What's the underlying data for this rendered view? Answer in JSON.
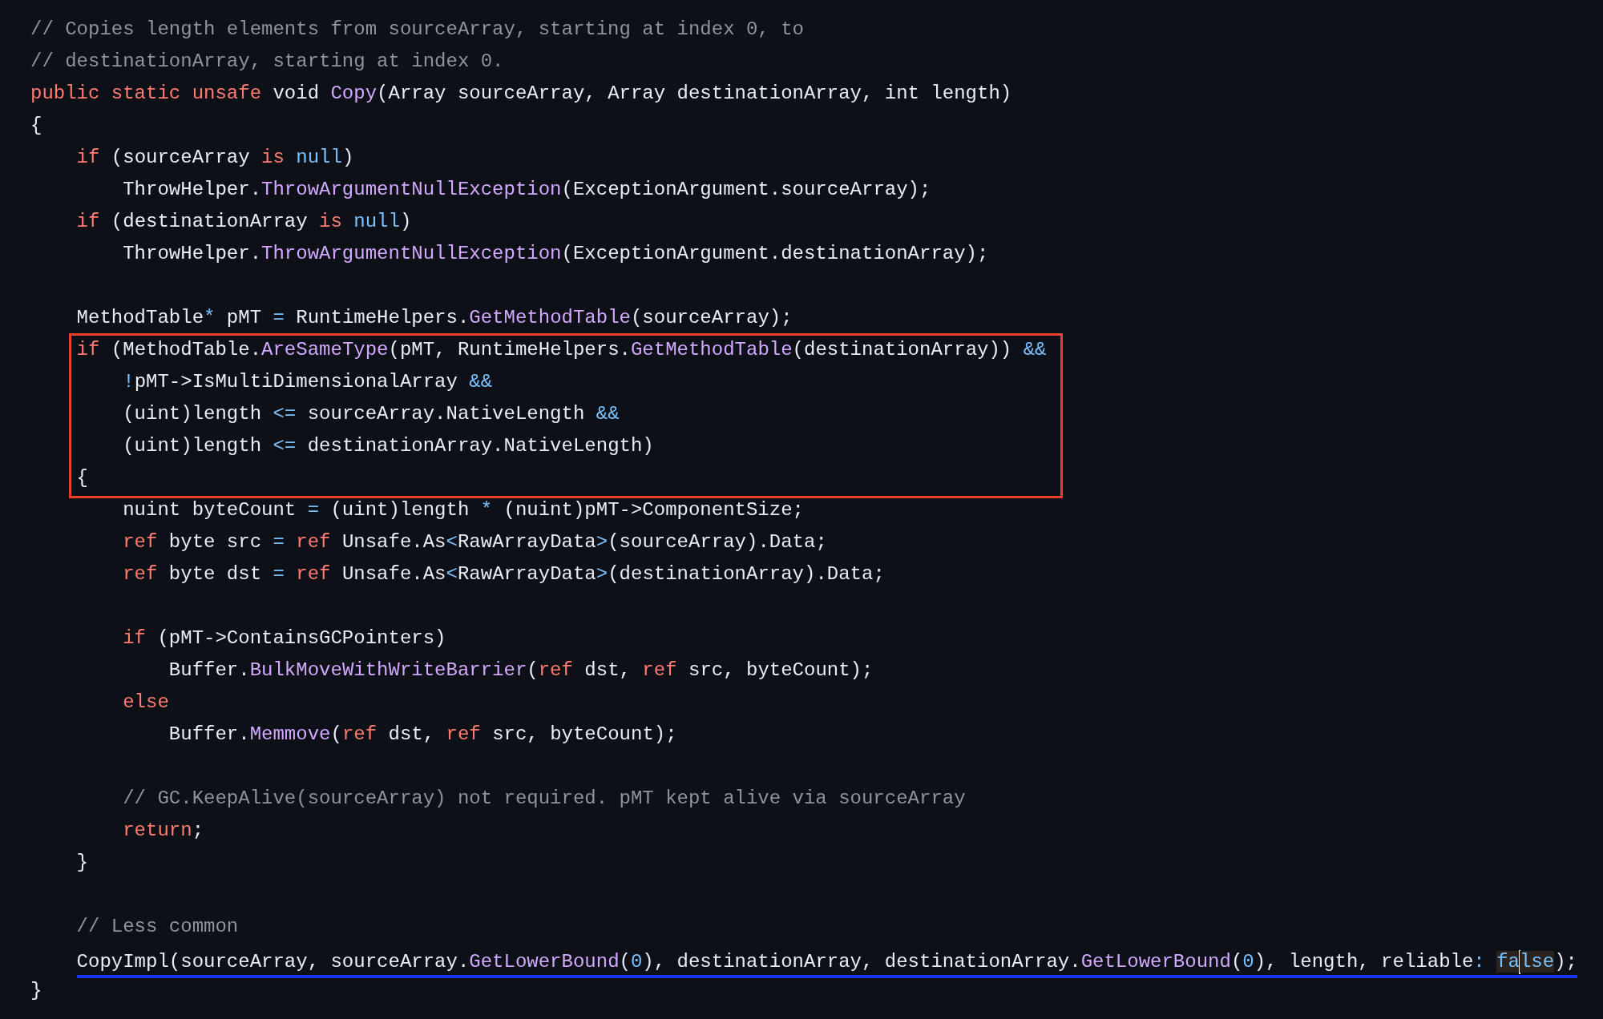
{
  "editor": {
    "lines": [
      {
        "kind": "code",
        "tokens": [
          {
            "kind": "comment",
            "text": "// Copies length elements from sourceArray, starting at index 0, to"
          }
        ]
      },
      {
        "kind": "code",
        "tokens": [
          {
            "kind": "comment",
            "text": "// destinationArray, starting at index 0."
          }
        ]
      },
      {
        "kind": "code",
        "tokens": [
          {
            "kind": "keyword",
            "text": "public static unsafe"
          },
          {
            "kind": "plain",
            "text": " void "
          },
          {
            "kind": "function",
            "text": "Copy"
          },
          {
            "kind": "plain",
            "text": "(Array sourceArray, Array destinationArray, int length)"
          }
        ]
      },
      {
        "kind": "code",
        "tokens": [
          {
            "kind": "plain",
            "text": "{"
          }
        ]
      },
      {
        "kind": "block",
        "children": [
          {
            "kind": "code",
            "tokens": [
              {
                "kind": "keyword",
                "text": "if"
              },
              {
                "kind": "plain",
                "text": " (sourceArray "
              },
              {
                "kind": "keyword",
                "text": "is "
              },
              {
                "kind": "constant",
                "text": "null"
              },
              {
                "kind": "plain",
                "text": ")"
              }
            ]
          },
          {
            "kind": "block",
            "children": [
              {
                "kind": "code",
                "tokens": [
                  {
                    "kind": "plain",
                    "text": "ThrowHelper."
                  },
                  {
                    "kind": "function",
                    "text": "ThrowArgumentNullException"
                  },
                  {
                    "kind": "plain",
                    "text": "(ExceptionArgument.sourceArray);"
                  }
                ]
              }
            ]
          },
          {
            "kind": "code",
            "tokens": [
              {
                "kind": "keyword",
                "text": "if"
              },
              {
                "kind": "plain",
                "text": " (destinationArray "
              },
              {
                "kind": "keyword",
                "text": "is "
              },
              {
                "kind": "constant",
                "text": "null"
              },
              {
                "kind": "plain",
                "text": ")"
              }
            ]
          },
          {
            "kind": "block",
            "children": [
              {
                "kind": "code",
                "tokens": [
                  {
                    "kind": "plain",
                    "text": "ThrowHelper."
                  },
                  {
                    "kind": "function",
                    "text": "ThrowArgumentNullException"
                  },
                  {
                    "kind": "plain",
                    "text": "(ExceptionArgument.destinationArray);"
                  }
                ]
              }
            ]
          },
          {
            "kind": "blank"
          },
          {
            "kind": "code",
            "tokens": [
              {
                "kind": "plain",
                "text": "MethodTable"
              },
              {
                "kind": "constant",
                "text": "*"
              },
              {
                "kind": "plain",
                "text": " pMT "
              },
              {
                "kind": "constant",
                "text": "="
              },
              {
                "kind": "plain",
                "text": " RuntimeHelpers."
              },
              {
                "kind": "function",
                "text": "GetMethodTable"
              },
              {
                "kind": "plain",
                "text": "(sourceArray);"
              }
            ]
          },
          {
            "kind": "frame",
            "children": [
              {
                "kind": "code",
                "tokens": [
                  {
                    "kind": "keyword",
                    "text": "if"
                  },
                  {
                    "kind": "plain",
                    "text": " (MethodTable."
                  },
                  {
                    "kind": "function",
                    "text": "AreSameType"
                  },
                  {
                    "kind": "plain",
                    "text": "(pMT, RuntimeHelpers."
                  },
                  {
                    "kind": "function",
                    "text": "GetMethodTable"
                  },
                  {
                    "kind": "plain",
                    "text": "(destinationArray)) "
                  },
                  {
                    "kind": "constant",
                    "text": "&&"
                  }
                ]
              },
              {
                "kind": "block",
                "children": [
                  {
                    "kind": "code",
                    "tokens": [
                      {
                        "kind": "constant",
                        "text": "!"
                      },
                      {
                        "kind": "plain",
                        "text": "pMT->IsMultiDimensionalArray "
                      },
                      {
                        "kind": "constant",
                        "text": "&&"
                      }
                    ]
                  },
                  {
                    "kind": "code",
                    "tokens": [
                      {
                        "kind": "plain",
                        "text": "(uint)length "
                      },
                      {
                        "kind": "constant",
                        "text": "<="
                      },
                      {
                        "kind": "plain",
                        "text": " sourceArray.NativeLength "
                      },
                      {
                        "kind": "constant",
                        "text": "&&"
                      }
                    ]
                  },
                  {
                    "kind": "code",
                    "tokens": [
                      {
                        "kind": "plain",
                        "text": "(uint)length "
                      },
                      {
                        "kind": "constant",
                        "text": "<="
                      },
                      {
                        "kind": "plain",
                        "text": " destinationArray.NativeLength)"
                      }
                    ]
                  }
                ]
              },
              {
                "kind": "code",
                "tokens": [
                  {
                    "kind": "plain",
                    "text": "{"
                  }
                ]
              }
            ]
          },
          {
            "kind": "block",
            "children": [
              {
                "kind": "code",
                "tokens": [
                  {
                    "kind": "plain",
                    "text": "nuint byteCount "
                  },
                  {
                    "kind": "constant",
                    "text": "="
                  },
                  {
                    "kind": "plain",
                    "text": " (uint)length "
                  },
                  {
                    "kind": "constant",
                    "text": "*"
                  },
                  {
                    "kind": "plain",
                    "text": " (nuint)pMT->ComponentSize;"
                  }
                ]
              },
              {
                "kind": "code",
                "tokens": [
                  {
                    "kind": "keyword",
                    "text": "ref"
                  },
                  {
                    "kind": "plain",
                    "text": " byte src "
                  },
                  {
                    "kind": "constant",
                    "text": "= "
                  },
                  {
                    "kind": "keyword",
                    "text": "ref"
                  },
                  {
                    "kind": "plain",
                    "text": " Unsafe.As"
                  },
                  {
                    "kind": "constant",
                    "text": "<"
                  },
                  {
                    "kind": "plain",
                    "text": "RawArrayData"
                  },
                  {
                    "kind": "constant",
                    "text": ">"
                  },
                  {
                    "kind": "plain",
                    "text": "(sourceArray).Data;"
                  }
                ]
              },
              {
                "kind": "code",
                "tokens": [
                  {
                    "kind": "keyword",
                    "text": "ref"
                  },
                  {
                    "kind": "plain",
                    "text": " byte dst "
                  },
                  {
                    "kind": "constant",
                    "text": "= "
                  },
                  {
                    "kind": "keyword",
                    "text": "ref"
                  },
                  {
                    "kind": "plain",
                    "text": " Unsafe.As"
                  },
                  {
                    "kind": "constant",
                    "text": "<"
                  },
                  {
                    "kind": "plain",
                    "text": "RawArrayData"
                  },
                  {
                    "kind": "constant",
                    "text": ">"
                  },
                  {
                    "kind": "plain",
                    "text": "(destinationArray).Data;"
                  }
                ]
              },
              {
                "kind": "blank"
              },
              {
                "kind": "code",
                "tokens": [
                  {
                    "kind": "keyword",
                    "text": "if"
                  },
                  {
                    "kind": "plain",
                    "text": " (pMT->ContainsGCPointers)"
                  }
                ]
              },
              {
                "kind": "block",
                "children": [
                  {
                    "kind": "code",
                    "tokens": [
                      {
                        "kind": "plain",
                        "text": "Buffer."
                      },
                      {
                        "kind": "function",
                        "text": "BulkMoveWithWriteBarrier"
                      },
                      {
                        "kind": "plain",
                        "text": "("
                      },
                      {
                        "kind": "keyword",
                        "text": "ref"
                      },
                      {
                        "kind": "plain",
                        "text": " dst, "
                      },
                      {
                        "kind": "keyword",
                        "text": "ref"
                      },
                      {
                        "kind": "plain",
                        "text": " src, byteCount);"
                      }
                    ]
                  }
                ]
              },
              {
                "kind": "code",
                "tokens": [
                  {
                    "kind": "keyword",
                    "text": "else"
                  }
                ]
              },
              {
                "kind": "block",
                "children": [
                  {
                    "kind": "code",
                    "tokens": [
                      {
                        "kind": "plain",
                        "text": "Buffer."
                      },
                      {
                        "kind": "function",
                        "text": "Memmove"
                      },
                      {
                        "kind": "plain",
                        "text": "("
                      },
                      {
                        "kind": "keyword",
                        "text": "ref"
                      },
                      {
                        "kind": "plain",
                        "text": " dst, "
                      },
                      {
                        "kind": "keyword",
                        "text": "ref"
                      },
                      {
                        "kind": "plain",
                        "text": " src, byteCount);"
                      }
                    ]
                  }
                ]
              },
              {
                "kind": "blank"
              },
              {
                "kind": "code",
                "tokens": [
                  {
                    "kind": "comment",
                    "text": "// GC.KeepAlive(sourceArray) not required. pMT kept alive via sourceArray"
                  }
                ]
              },
              {
                "kind": "code",
                "tokens": [
                  {
                    "kind": "keyword",
                    "text": "return"
                  },
                  {
                    "kind": "plain",
                    "text": ";"
                  }
                ]
              }
            ]
          },
          {
            "kind": "code",
            "tokens": [
              {
                "kind": "plain",
                "text": "}"
              }
            ]
          },
          {
            "kind": "blank"
          },
          {
            "kind": "code",
            "tokens": [
              {
                "kind": "comment",
                "text": "// Less common"
              }
            ]
          },
          {
            "kind": "code",
            "underlined": true,
            "tokens": [
              {
                "kind": "plain",
                "text": "CopyImpl(sourceArray, sourceArray."
              },
              {
                "kind": "function",
                "text": "GetLowerBound"
              },
              {
                "kind": "plain",
                "text": "("
              },
              {
                "kind": "constant",
                "text": "0"
              },
              {
                "kind": "plain",
                "text": "), destinationArray, destinationArray."
              },
              {
                "kind": "function",
                "text": "GetLowerBound"
              },
              {
                "kind": "plain",
                "text": "("
              },
              {
                "kind": "constant",
                "text": "0"
              },
              {
                "kind": "plain",
                "text": "), length, reliable"
              },
              {
                "kind": "constant",
                "text": ": "
              },
              {
                "kind": "constant",
                "text": "fa",
                "highlighted": true
              },
              {
                "kind": "cursor"
              },
              {
                "kind": "constant",
                "text": "lse",
                "highlighted": true
              },
              {
                "kind": "plain",
                "text": ");"
              }
            ]
          }
        ]
      },
      {
        "kind": "code",
        "tokens": [
          {
            "kind": "plain",
            "text": "}"
          }
        ]
      }
    ]
  }
}
